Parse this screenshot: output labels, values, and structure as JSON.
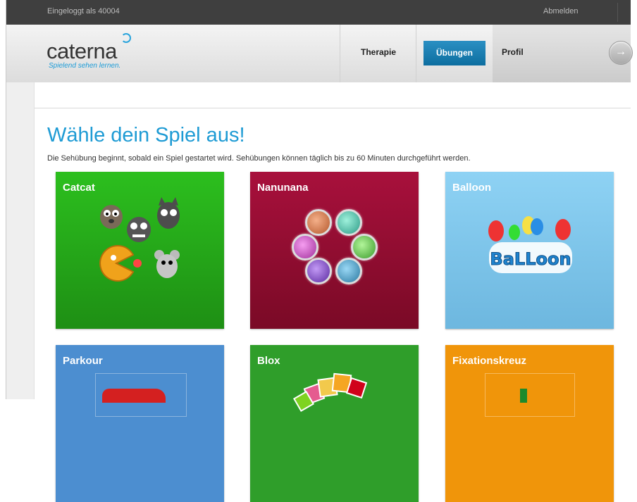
{
  "topbar": {
    "login_text": "Eingeloggt als 40004",
    "logout_label": "Abmelden"
  },
  "logo": {
    "word": "caterna",
    "tagline": "Spielend sehen lernen."
  },
  "nav": {
    "items": [
      "Therapie",
      "Übungen",
      "Profil"
    ],
    "active": "Übungen",
    "next_arrow": "→"
  },
  "main": {
    "title": "Wähle dein Spiel aus!",
    "subtitle": "Die Sehübung beginnt, sobald ein Spiel gestartet wird. Sehübungen können täglich bis zu 60 Minuten durchgeführt werden."
  },
  "games": [
    {
      "name": "Catcat",
      "color": "#2cbf1e"
    },
    {
      "name": "Nanunana",
      "color": "#a8103c"
    },
    {
      "name": "Balloon",
      "color": "#8ed2f4",
      "logo_text": "BaLLoon"
    },
    {
      "name": "Parkour",
      "color": "#4c8ed0"
    },
    {
      "name": "Blox",
      "color": "#2f9e2a"
    },
    {
      "name": "Fixationskreuz",
      "color": "#f0950a"
    }
  ]
}
